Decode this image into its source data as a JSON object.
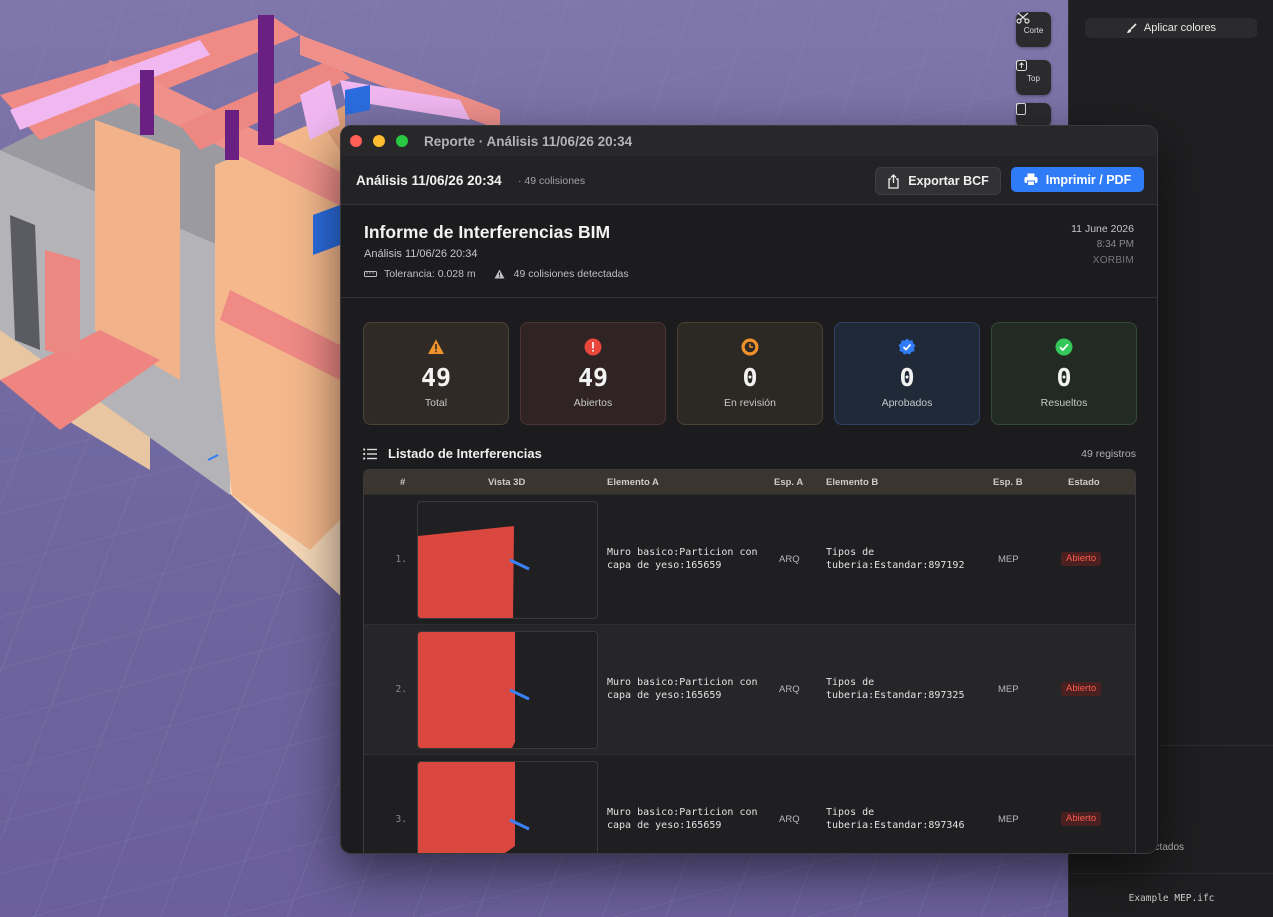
{
  "viewport": {
    "toolbar": [
      {
        "label": "Corte",
        "icon": "scissors-icon"
      },
      {
        "label": "Top",
        "icon": "arrow-up-square-icon"
      },
      {
        "label": "",
        "icon": "square-icon"
      }
    ]
  },
  "sidepanel": {
    "apply_colors_label": "Aplicar colores",
    "detected_text": "ectados",
    "file_name": "Example MEP.ifc"
  },
  "window": {
    "title": "Reporte · Análisis 11/06/26 20:34"
  },
  "toolbar": {
    "analysis_title": "Análisis 11/06/26 20:34",
    "collision_count": "· 49 colisiones",
    "export_bcf_label": "Exportar BCF",
    "print_pdf_label": "Imprimir / PDF"
  },
  "report": {
    "title": "Informe de Interferencias BIM",
    "subtitle": "Análisis 11/06/26 20:34",
    "tolerance": "Tolerancia: 0.028 m",
    "detected": "49 colisiones detectadas",
    "date": "11 June 2026",
    "time": "8:34 PM",
    "brand": "XORBIM"
  },
  "stats": [
    {
      "value": "49",
      "label": "Total",
      "icon": "warning-triangle-icon",
      "color": "#f0922b"
    },
    {
      "value": "49",
      "label": "Abiertos",
      "icon": "exclamation-circle-icon",
      "color": "#e8453c"
    },
    {
      "value": "0",
      "label": "En revisión",
      "icon": "clock-icon",
      "color": "#f0922b"
    },
    {
      "value": "0",
      "label": "Aprobados",
      "icon": "verified-badge-icon",
      "color": "#2f7cf6"
    },
    {
      "value": "0",
      "label": "Resueltos",
      "icon": "check-circle-icon",
      "color": "#34c759"
    }
  ],
  "list": {
    "title": "Listado de Interferencias",
    "count": "49 registros",
    "columns": [
      "#",
      "Vista 3D",
      "Elemento A",
      "Esp. A",
      "Elemento B",
      "Esp. B",
      "Estado"
    ],
    "rows": [
      {
        "index": "1.",
        "element_a": "Muro basico:Particion con capa de yeso:165659",
        "esp_a": "ARQ",
        "element_b": "Tipos de tuberia:Estandar:897192",
        "esp_b": "MEP",
        "status": "Abierto"
      },
      {
        "index": "2.",
        "element_a": "Muro basico:Particion con capa de yeso:165659",
        "esp_a": "ARQ",
        "element_b": "Tipos de tuberia:Estandar:897325",
        "esp_b": "MEP",
        "status": "Abierto"
      },
      {
        "index": "3.",
        "element_a": "Muro basico:Particion con capa de yeso:165659",
        "esp_a": "ARQ",
        "element_b": "Tipos de tuberia:Estandar:897346",
        "esp_b": "MEP",
        "status": "Abierto"
      }
    ]
  },
  "colors": {
    "accent": "#2f7cf6",
    "status_open": "#ff5a4f",
    "wall_red": "#d9473f"
  }
}
